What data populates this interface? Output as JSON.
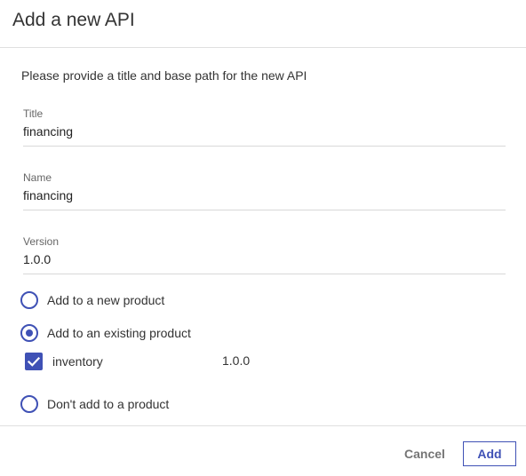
{
  "dialog": {
    "title": "Add a new API",
    "intro": "Please provide a title and base path for the new API"
  },
  "fields": {
    "title": {
      "label": "Title",
      "value": "financing"
    },
    "name": {
      "label": "Name",
      "value": "financing"
    },
    "version": {
      "label": "Version",
      "value": "1.0.0"
    }
  },
  "product_options": [
    {
      "label": "Add to a new product",
      "selected": false
    },
    {
      "label": "Add to an existing product",
      "selected": true
    },
    {
      "label": "Don't add to a product",
      "selected": false
    }
  ],
  "existing_products": [
    {
      "name": "inventory",
      "version": "1.0.0",
      "checked": true
    }
  ],
  "footer": {
    "cancel_label": "Cancel",
    "add_label": "Add"
  },
  "colors": {
    "accent": "#3f51b5",
    "cancel_text": "#757575",
    "divider": "#e0e0e0"
  },
  "icons": {
    "checkbox": "check-icon"
  }
}
